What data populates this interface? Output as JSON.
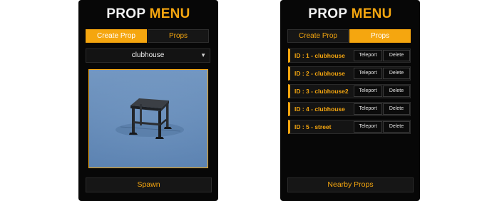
{
  "title": {
    "part1": "PROP",
    "part2": "MENU"
  },
  "tabs": {
    "create": "Create Prop",
    "props": "Props"
  },
  "create_view": {
    "selected_prop": "clubhouse",
    "spawn_label": "Spawn"
  },
  "props_view": {
    "items": [
      {
        "id_label": "ID : 1 - clubhouse"
      },
      {
        "id_label": "ID : 2 - clubhouse"
      },
      {
        "id_label": "ID : 3 - clubhouse2"
      },
      {
        "id_label": "ID : 4 - clubhouse"
      },
      {
        "id_label": "ID : 5 - street"
      }
    ],
    "teleport_label": "Teleport",
    "delete_label": "Delete",
    "nearby_label": "Nearby Props"
  },
  "colors": {
    "accent": "#f5a60f",
    "panel_bg": "#070707",
    "button_bg": "#161616",
    "preview_sky": "#7ea1c9"
  },
  "icons": {
    "dropdown": "chevron-down-icon"
  }
}
